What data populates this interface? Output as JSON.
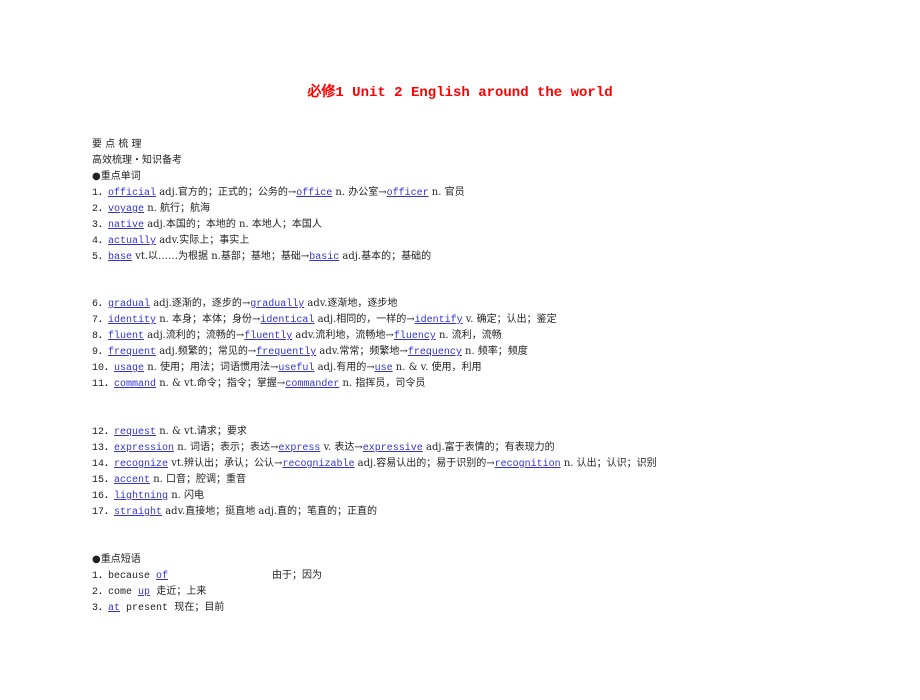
{
  "title": "必修1  Unit 2  English around the world",
  "headers": {
    "section": "要 点 梳 理",
    "subsection": "高效梳理・知识备考",
    "vocab_heading": "●重点单词",
    "phrase_heading": "●重点短语"
  },
  "vocab": [
    {
      "num": "1．",
      "parts": [
        {
          "k": "official"
        },
        {
          "t": " adj.官方的；正式的；公务的→"
        },
        {
          "k": "office"
        },
        {
          "t": " n. 办公室→"
        },
        {
          "k": "officer"
        },
        {
          "t": " n. 官员"
        }
      ]
    },
    {
      "num": "2．",
      "parts": [
        {
          "k": "voyage"
        },
        {
          "t": " n. 航行；航海"
        }
      ]
    },
    {
      "num": "3．",
      "parts": [
        {
          "k": "native"
        },
        {
          "t": " adj.本国的；本地的 n. 本地人；本国人"
        }
      ]
    },
    {
      "num": "4．",
      "parts": [
        {
          "k": "actually"
        },
        {
          "t": " adv.实际上；事实上"
        }
      ]
    },
    {
      "num": "5．",
      "parts": [
        {
          "k": "base"
        },
        {
          "t": " vt.以……为根据 n.基部；基地；基础→"
        },
        {
          "k": "basic"
        },
        {
          "t": " adj.基本的；基础的"
        }
      ]
    },
    {
      "num": "6．",
      "parts": [
        {
          "k": "gradual"
        },
        {
          "t": " adj.逐渐的，逐步的→"
        },
        {
          "k": "gradually"
        },
        {
          "t": " adv.逐渐地，逐步地"
        }
      ]
    },
    {
      "num": "7．",
      "parts": [
        {
          "k": "identity"
        },
        {
          "t": " n. 本身；本体；身份→"
        },
        {
          "k": "identical"
        },
        {
          "t": " adj.相同的，一样的→"
        },
        {
          "k": "identify"
        },
        {
          "t": " v. 确定；认出；鉴定"
        }
      ]
    },
    {
      "num": "8．",
      "parts": [
        {
          "k": "fluent"
        },
        {
          "t": " adj.流利的；流畅的→"
        },
        {
          "k": "fluently"
        },
        {
          "t": " adv.流利地，流畅地→"
        },
        {
          "k": "fluency"
        },
        {
          "t": " n. 流利，流畅"
        }
      ]
    },
    {
      "num": "9．",
      "parts": [
        {
          "k": "frequent"
        },
        {
          "t": " adj.频繁的；常见的→"
        },
        {
          "k": "frequently"
        },
        {
          "t": " adv.常常；频繁地→"
        },
        {
          "k": "frequency"
        },
        {
          "t": " n. 频率；频度"
        }
      ]
    },
    {
      "num": "10．",
      "parts": [
        {
          "k": "usage"
        },
        {
          "t": " n. 使用；用法；词语惯用法→"
        },
        {
          "k": "useful"
        },
        {
          "t": " adj.有用的→"
        },
        {
          "k": "use"
        },
        {
          "t": " n. & v. 使用，利用"
        }
      ]
    },
    {
      "num": "11．",
      "parts": [
        {
          "k": "command"
        },
        {
          "t": " n. & vt.命令；指令；掌握→"
        },
        {
          "k": "commander"
        },
        {
          "t": " n. 指挥员，司令员"
        }
      ]
    },
    {
      "num": "12．",
      "parts": [
        {
          "k": "request"
        },
        {
          "t": " n. & vt.请求；要求"
        }
      ]
    },
    {
      "num": "13．",
      "parts": [
        {
          "k": "expression"
        },
        {
          "t": " n. 词语；表示；表达→"
        },
        {
          "k": "express"
        },
        {
          "t": " v. 表达→"
        },
        {
          "k": "expressive"
        },
        {
          "t": " adj.富于表情的；有表现力的"
        }
      ]
    },
    {
      "num": "14．",
      "parts": [
        {
          "k": "recognize"
        },
        {
          "t": " vt.辨认出；承认；公认→"
        },
        {
          "k": "recognizable"
        },
        {
          "t": " adj.容易认出的；易于识别的→"
        },
        {
          "k": "recognition"
        },
        {
          "t": " n. 认出；认识；识别"
        }
      ]
    },
    {
      "num": "15．",
      "parts": [
        {
          "k": "accent"
        },
        {
          "t": " n. 口音；腔调；重音"
        }
      ]
    },
    {
      "num": "16．",
      "parts": [
        {
          "k": "lightning"
        },
        {
          "t": " n. 闪电"
        }
      ]
    },
    {
      "num": "17．",
      "parts": [
        {
          "k": "straight"
        },
        {
          "t": " adv.直接地；挺直地 adj.直的；笔直的；正直的"
        }
      ]
    }
  ],
  "phrases": [
    {
      "num": "1．",
      "pre": "because ",
      "k": "of",
      "post": "",
      "meaning": "由于；因为",
      "wide": true
    },
    {
      "num": "2．",
      "pre": "come ",
      "k": "up",
      "post": "",
      "meaning": "  走近；上来",
      "wide": false
    },
    {
      "num": "3．",
      "pre": "",
      "k": "at",
      "post": " present",
      "meaning": "  现在；目前",
      "wide": false
    }
  ]
}
